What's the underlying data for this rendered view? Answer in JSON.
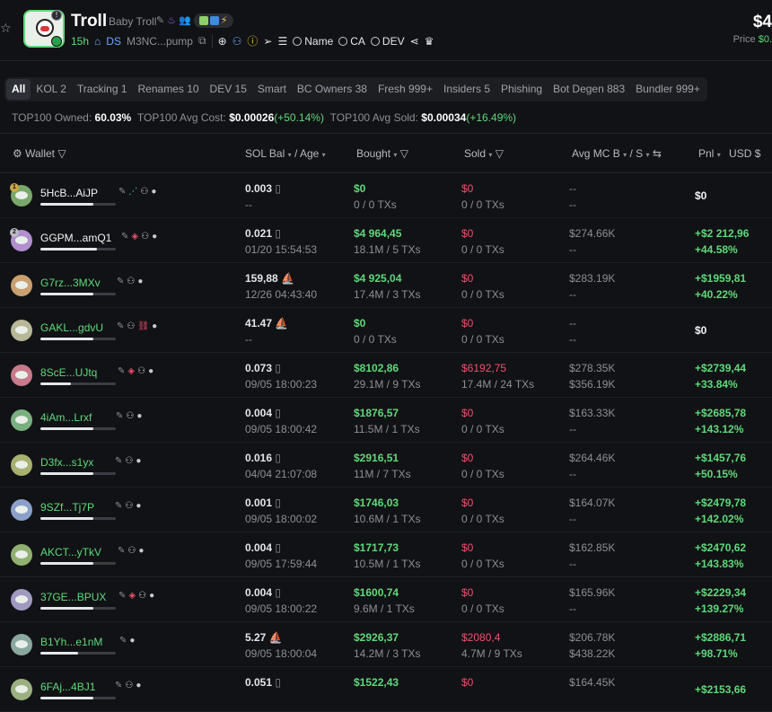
{
  "header": {
    "token_name": "Troll",
    "token_subtitle": "Baby Troll",
    "age": "15h",
    "ds": "DS",
    "address": "M3NC...pump",
    "search_name": "Name",
    "search_ca": "CA",
    "search_dev": "DEV",
    "price": "$4",
    "price_label": "Price",
    "price_change": "$0."
  },
  "tabs": [
    {
      "label": "All",
      "active": true
    },
    {
      "label": "KOL 2"
    },
    {
      "label": "Tracking 1"
    },
    {
      "label": "Renames 10"
    },
    {
      "label": "DEV 15"
    },
    {
      "label": "Smart"
    },
    {
      "label": "BC Owners 38"
    },
    {
      "label": "Fresh 999+"
    },
    {
      "label": "Insiders 5"
    },
    {
      "label": "Phishing"
    },
    {
      "label": "Bot Degen 883"
    },
    {
      "label": "Bundler 999+"
    }
  ],
  "stats": {
    "owned_label": "TOP100 Owned:",
    "owned_value": "60.03%",
    "cost_label": "TOP100 Avg Cost:",
    "cost_value": "$0.00026",
    "cost_change": "(+50.14%)",
    "sold_label": "TOP100 Avg Sold:",
    "sold_value": "$0.00034",
    "sold_change": "(+16.49%)"
  },
  "columns": {
    "wallet": "Wallet",
    "sol_bal": "SOL Bal",
    "age": "/ Age",
    "bought": "Bought",
    "sold": "Sold",
    "avg_mc": "Avg MC B",
    "avg_mc_s": "/ S",
    "pnl": "Pnl",
    "usd": "USD"
  },
  "rows": [
    {
      "rank": "1",
      "wallet": "5HcB...AiJP",
      "bar": 0.7,
      "sol": "0.003",
      "age": "--",
      "bought": "$0",
      "bought_tx": "0 / 0 TXs",
      "sold": "$0",
      "sold_tx": "0 / 0 TXs",
      "mc_b": "--",
      "mc_s": "--",
      "pnl": "$0",
      "pnl_pct": ""
    },
    {
      "rank": "2",
      "wallet": "GGPM...amQ1",
      "bar": 0.75,
      "sol": "0.021",
      "age": "01/20 15:54:53",
      "bought": "$4 964,45",
      "bought_tx": "18.1M / 5 TXs",
      "sold": "$0",
      "sold_tx": "0 / 0 TXs",
      "mc_b": "$274.66K",
      "mc_s": "--",
      "pnl": "+$2 212,96",
      "pnl_pct": "+44.58%"
    },
    {
      "rank": "",
      "wallet": "G7rz...3MXv",
      "bar": 0.7,
      "sol": "159,88",
      "age": "12/26 04:43:40",
      "bought": "$4 925,04",
      "bought_tx": "17.4M / 3 TXs",
      "sold": "$0",
      "sold_tx": "0 / 0 TXs",
      "mc_b": "$283.19K",
      "mc_s": "--",
      "pnl": "+$1959,81",
      "pnl_pct": "+40.22%"
    },
    {
      "rank": "",
      "wallet": "GAKL...gdvU",
      "bar": 0.7,
      "sol": "41.47",
      "age": "--",
      "bought": "$0",
      "bought_tx": "0 / 0 TXs",
      "sold": "$0",
      "sold_tx": "0 / 0 TXs",
      "mc_b": "--",
      "mc_s": "--",
      "pnl": "$0",
      "pnl_pct": ""
    },
    {
      "rank": "",
      "wallet": "8ScE...UJtq",
      "bar": 0.4,
      "sol": "0.073",
      "age": "09/05 18:00:23",
      "bought": "$8102,86",
      "bought_tx": "29.1M / 9 TXs",
      "sold": "$6192,75",
      "sold_tx": "17.4M / 24 TXs",
      "mc_b": "$278.35K",
      "mc_s": "$356.19K",
      "pnl": "+$2739,44",
      "pnl_pct": "+33.84%"
    },
    {
      "rank": "",
      "wallet": "4iAm...Lrxf",
      "bar": 0.7,
      "sol": "0.004",
      "age": "09/05 18:00:42",
      "bought": "$1876,57",
      "bought_tx": "11.5M / 1 TXs",
      "sold": "$0",
      "sold_tx": "0 / 0 TXs",
      "mc_b": "$163.33K",
      "mc_s": "--",
      "pnl": "+$2685,78",
      "pnl_pct": "+143.12%"
    },
    {
      "rank": "",
      "wallet": "D3fx...s1yx",
      "bar": 0.7,
      "sol": "0.016",
      "age": "04/04 21:07:08",
      "bought": "$2916,51",
      "bought_tx": "11M / 7 TXs",
      "sold": "$0",
      "sold_tx": "0 / 0 TXs",
      "mc_b": "$264.46K",
      "mc_s": "--",
      "pnl": "+$1457,76",
      "pnl_pct": "+50.15%"
    },
    {
      "rank": "",
      "wallet": "9SZf...Tj7P",
      "bar": 0.7,
      "sol": "0.001",
      "age": "09/05 18:00:02",
      "bought": "$1746,03",
      "bought_tx": "10.6M / 1 TXs",
      "sold": "$0",
      "sold_tx": "0 / 0 TXs",
      "mc_b": "$164.07K",
      "mc_s": "--",
      "pnl": "+$2479,78",
      "pnl_pct": "+142.02%"
    },
    {
      "rank": "",
      "wallet": "AKCT...yTkV",
      "bar": 0.7,
      "sol": "0.004",
      "age": "09/05 17:59:44",
      "bought": "$1717,73",
      "bought_tx": "10.5M / 1 TXs",
      "sold": "$0",
      "sold_tx": "0 / 0 TXs",
      "mc_b": "$162.85K",
      "mc_s": "--",
      "pnl": "+$2470,62",
      "pnl_pct": "+143.83%"
    },
    {
      "rank": "",
      "wallet": "37GE...BPUX",
      "bar": 0.7,
      "sol": "0.004",
      "age": "09/05 18:00:22",
      "bought": "$1600,74",
      "bought_tx": "9.6M / 1 TXs",
      "sold": "$0",
      "sold_tx": "0 / 0 TXs",
      "mc_b": "$165.96K",
      "mc_s": "--",
      "pnl": "+$2229,34",
      "pnl_pct": "+139.27%"
    },
    {
      "rank": "",
      "wallet": "B1Yh...e1nM",
      "bar": 0.5,
      "sol": "5.27",
      "age": "09/05 18:00:04",
      "bought": "$2926,37",
      "bought_tx": "14.2M / 3 TXs",
      "sold": "$2080,4",
      "sold_tx": "4.7M / 9 TXs",
      "mc_b": "$206.78K",
      "mc_s": "$438.22K",
      "pnl": "+$2886,71",
      "pnl_pct": "+98.71%"
    },
    {
      "rank": "",
      "wallet": "6FAj...4BJ1",
      "bar": 0.7,
      "sol": "0.051",
      "age": "",
      "bought": "$1522,43",
      "bought_tx": "",
      "sold": "$0",
      "sold_tx": "",
      "mc_b": "$164.45K",
      "mc_s": "",
      "pnl": "+$2153,66",
      "pnl_pct": ""
    }
  ],
  "colors": {
    "green": "#5fd97a",
    "red": "#f0506e",
    "accent": "#5fd97a"
  }
}
